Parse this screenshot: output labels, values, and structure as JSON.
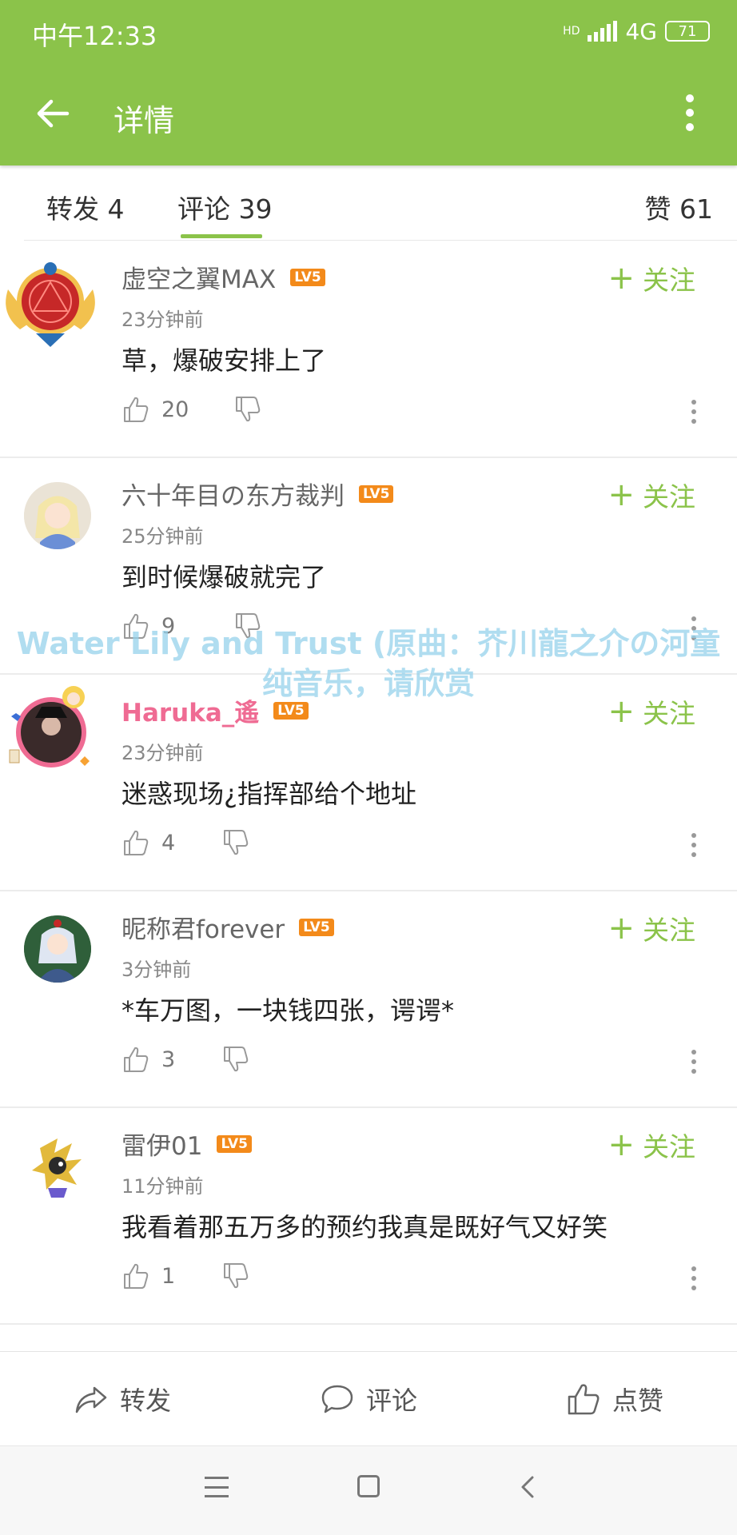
{
  "status_bar": {
    "time": "中午12:33",
    "network": "4G",
    "hd": "HD",
    "battery": "71"
  },
  "app_bar": {
    "title": "详情"
  },
  "tabs": {
    "forward": "转发 4",
    "comments": "评论 39",
    "likes": "赞 61"
  },
  "comments": [
    {
      "username": "虚空之翼MAX",
      "level": "LV5",
      "time": "23分钟前",
      "text": "草，爆破安排上了",
      "likes": "20",
      "follow": "关注",
      "avatar_color": "#c62828"
    },
    {
      "username": "六十年目の东方裁判",
      "level": "LV5",
      "time": "25分钟前",
      "text": "到时候爆破就完了",
      "likes": "9",
      "follow": "关注",
      "avatar_color": "#d9cdb8"
    },
    {
      "username": "Haruka_遙",
      "level": "LV5",
      "time": "23分钟前",
      "text": "迷惑现场¿指挥部给个地址",
      "likes": "4",
      "follow": "关注",
      "avatar_color": "#5a3a3a"
    },
    {
      "username": "昵称君forever",
      "level": "LV5",
      "time": "3分钟前",
      "text": "*车万图，一块钱四张，谔谔*",
      "likes": "3",
      "follow": "关注",
      "avatar_color": "#3e5a8c"
    },
    {
      "username": "雷伊01",
      "level": "LV5",
      "time": "11分钟前",
      "text": "我看着那五万多的预约我真是既好气又好笑",
      "likes": "1",
      "follow": "关注",
      "avatar_color": "#e2b93b"
    }
  ],
  "watermark": {
    "line1": "Water Lily and Trust (原曲：芥川龍之介の河童",
    "line2": "纯音乐，请欣赏"
  },
  "bottom_bar": {
    "forward": "转发",
    "comment": "评论",
    "like": "点赞"
  },
  "colors": {
    "accent": "#8bc34a",
    "level_badge": "#f38a1a",
    "vip_name": "#ef6b93"
  }
}
